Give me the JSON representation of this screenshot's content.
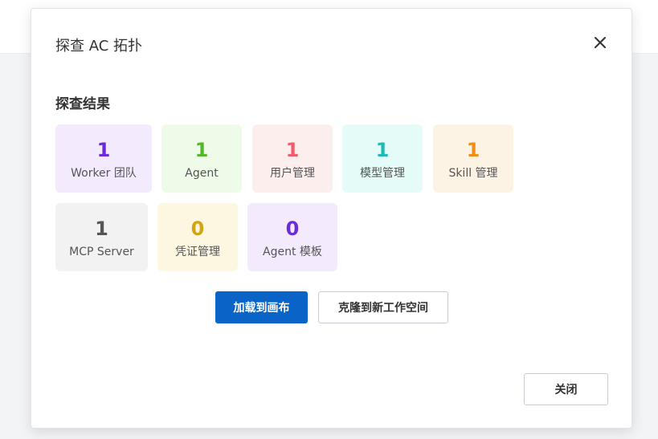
{
  "dialog": {
    "title": "探查 AC 拓扑",
    "close_icon": "close-icon"
  },
  "results": {
    "section_title": "探查结果",
    "stats": [
      {
        "value": "1",
        "label": "Worker 团队",
        "color": "#6b2bd6",
        "bg": "#f3eafe"
      },
      {
        "value": "1",
        "label": "Agent",
        "color": "#52b82a",
        "bg": "#eefbe8"
      },
      {
        "value": "1",
        "label": "用户管理",
        "color": "#ec5e6b",
        "bg": "#fdeeee"
      },
      {
        "value": "1",
        "label": "模型管理",
        "color": "#22b8b9",
        "bg": "#e5fbf8"
      },
      {
        "value": "1",
        "label": "Skill 管理",
        "color": "#f08c1a",
        "bg": "#fdf3e4"
      },
      {
        "value": "1",
        "label": "MCP Server",
        "color": "#555555",
        "bg": "#f2f2f2"
      },
      {
        "value": "0",
        "label": "凭证管理",
        "color": "#d4a312",
        "bg": "#fdf7e1"
      },
      {
        "value": "0",
        "label": "Agent 模板",
        "color": "#6b2bd6",
        "bg": "#f3eafe"
      }
    ]
  },
  "actions": {
    "load_label": "加载到画布",
    "clone_label": "克隆到新工作空间"
  },
  "footer": {
    "close_label": "关闭"
  }
}
